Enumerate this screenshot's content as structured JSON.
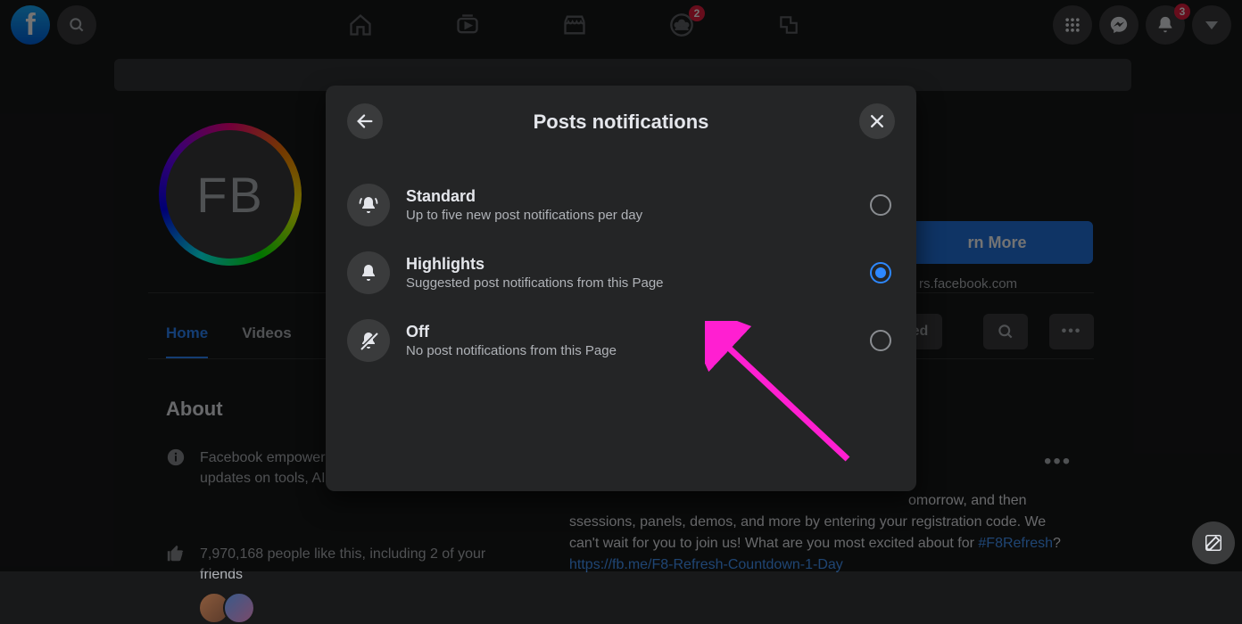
{
  "topbar": {
    "friends_badge": "2",
    "notif_badge": "3"
  },
  "page": {
    "avatar_text": "FB",
    "cta_label": "rn More",
    "url_text": "rs.facebook.com",
    "tabs": {
      "home": "Home",
      "videos": "Videos"
    },
    "sq_btn_text": "ed",
    "about": {
      "heading": "About",
      "intro": "Facebook empowers businesses to build us for updates on tools, AI, AR, VR, a",
      "likes_text": "7,970,168 people like this, including 2 of your friends"
    },
    "post": {
      "body_prefix": "omorrow, and then ssessions, panels, demos, and more by entering your registration code. We can't wait for you to join us! What are you most excited about for ",
      "hashtag": "#F8Refresh",
      "qmark": "?",
      "link": "https://fb.me/F8-Refresh-Countdown-1-Day"
    }
  },
  "modal": {
    "title": "Posts notifications",
    "options": [
      {
        "title": "Standard",
        "desc": "Up to five new post notifications per day"
      },
      {
        "title": "Highlights",
        "desc": "Suggested post notifications from this Page"
      },
      {
        "title": "Off",
        "desc": "No post notifications from this Page"
      }
    ]
  }
}
